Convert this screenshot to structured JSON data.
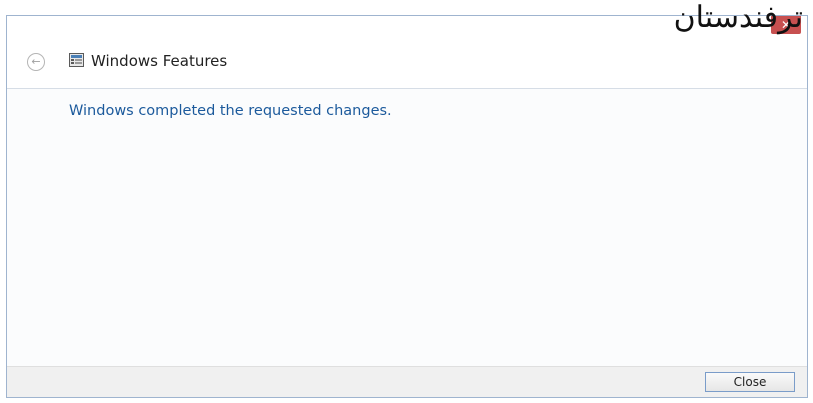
{
  "window": {
    "title": "Windows Features",
    "title_icon": "windows-features-icon",
    "close_glyph": "✕",
    "back_glyph": "←"
  },
  "watermark": {
    "text": "ترفندستان"
  },
  "main": {
    "message": "Windows completed the requested changes."
  },
  "footer": {
    "close_label": "Close"
  },
  "colors": {
    "accent_text": "#1c5a9c",
    "close_button_red": "#c75050",
    "button_border": "#7a9cc9"
  }
}
